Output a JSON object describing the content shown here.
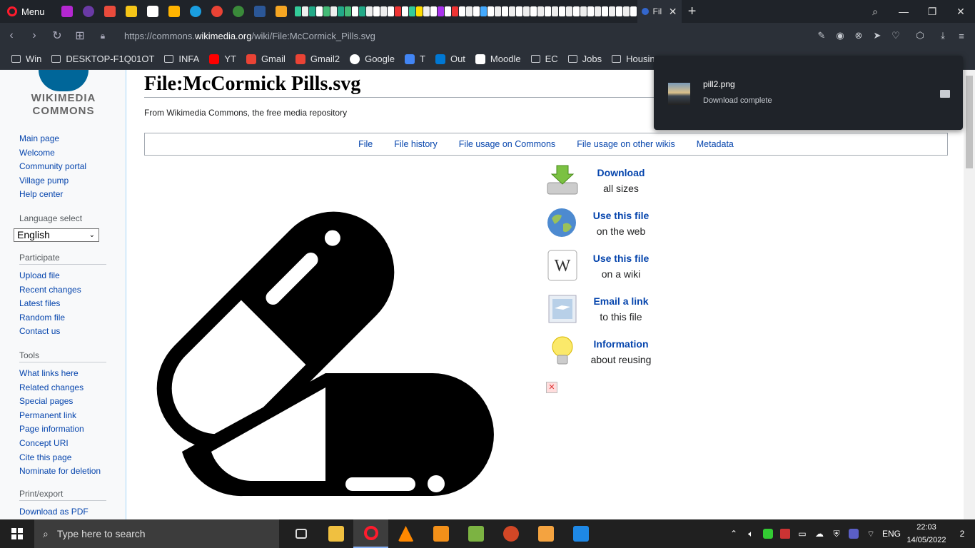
{
  "browser": {
    "menu_label": "Menu",
    "active_tab_title": "Fil",
    "url_prefix": "https://commons.",
    "url_host": "wikimedia.org",
    "url_path": "/wiki/File:McCormick_Pills.svg"
  },
  "bookmarks": [
    {
      "label": "Win",
      "icon": "folder-icon"
    },
    {
      "label": "DESKTOP-F1Q01OT",
      "icon": "folder-icon"
    },
    {
      "label": "INFA",
      "icon": "folder-icon"
    },
    {
      "label": "YT",
      "icon": "youtube-icon"
    },
    {
      "label": "Gmail",
      "icon": "gmail-icon"
    },
    {
      "label": "Gmail2",
      "icon": "gmail-icon"
    },
    {
      "label": "Google",
      "icon": "google-icon"
    },
    {
      "label": "T",
      "icon": "translate-icon"
    },
    {
      "label": "Out",
      "icon": "outlook-icon"
    },
    {
      "label": "Moodle",
      "icon": "moodle-icon"
    },
    {
      "label": "EC",
      "icon": "folder-icon"
    },
    {
      "label": "Jobs",
      "icon": "folder-icon"
    },
    {
      "label": "Housing",
      "icon": "folder-icon"
    }
  ],
  "download_popup": {
    "filename": "pill2.png",
    "status": "Download complete"
  },
  "sidebar": {
    "logo_line1": "WIKIMEDIA",
    "logo_line2": "COMMONS",
    "nav": [
      "Main page",
      "Welcome",
      "Community portal",
      "Village pump",
      "Help center"
    ],
    "language_heading": "Language select",
    "language_value": "English",
    "participate_heading": "Participate",
    "participate": [
      "Upload file",
      "Recent changes",
      "Latest files",
      "Random file",
      "Contact us"
    ],
    "tools_heading": "Tools",
    "tools": [
      "What links here",
      "Related changes",
      "Special pages",
      "Permanent link",
      "Page information",
      "Concept URI",
      "Cite this page",
      "Nominate for deletion"
    ],
    "print_heading": "Print/export",
    "print": [
      "Download as PDF"
    ]
  },
  "page": {
    "title": "File:McCormick Pills.svg",
    "subtitle": "From Wikimedia Commons, the free media repository",
    "tabs": [
      "File",
      "File history",
      "File usage on Commons",
      "File usage on other wikis",
      "Metadata"
    ]
  },
  "actions": [
    {
      "line1": "Download",
      "line2": "all sizes",
      "icon": "download-icon"
    },
    {
      "line1": "Use this file",
      "line2": "on the web",
      "icon": "globe-icon"
    },
    {
      "line1": "Use this file",
      "line2": "on a wiki",
      "icon": "wikipedia-icon"
    },
    {
      "line1": "Email a link",
      "line2": "to this file",
      "icon": "email-icon"
    },
    {
      "line1": "Information",
      "line2": "about reusing",
      "icon": "lightbulb-icon"
    }
  ],
  "taskbar": {
    "search_placeholder": "Type here to search",
    "language": "ENG",
    "time": "22:03",
    "date": "14/05/2022",
    "notifications": "2"
  },
  "colors": {
    "link": "#0645ad",
    "browser_dark": "#1f2329",
    "taskbar": "#202020"
  }
}
